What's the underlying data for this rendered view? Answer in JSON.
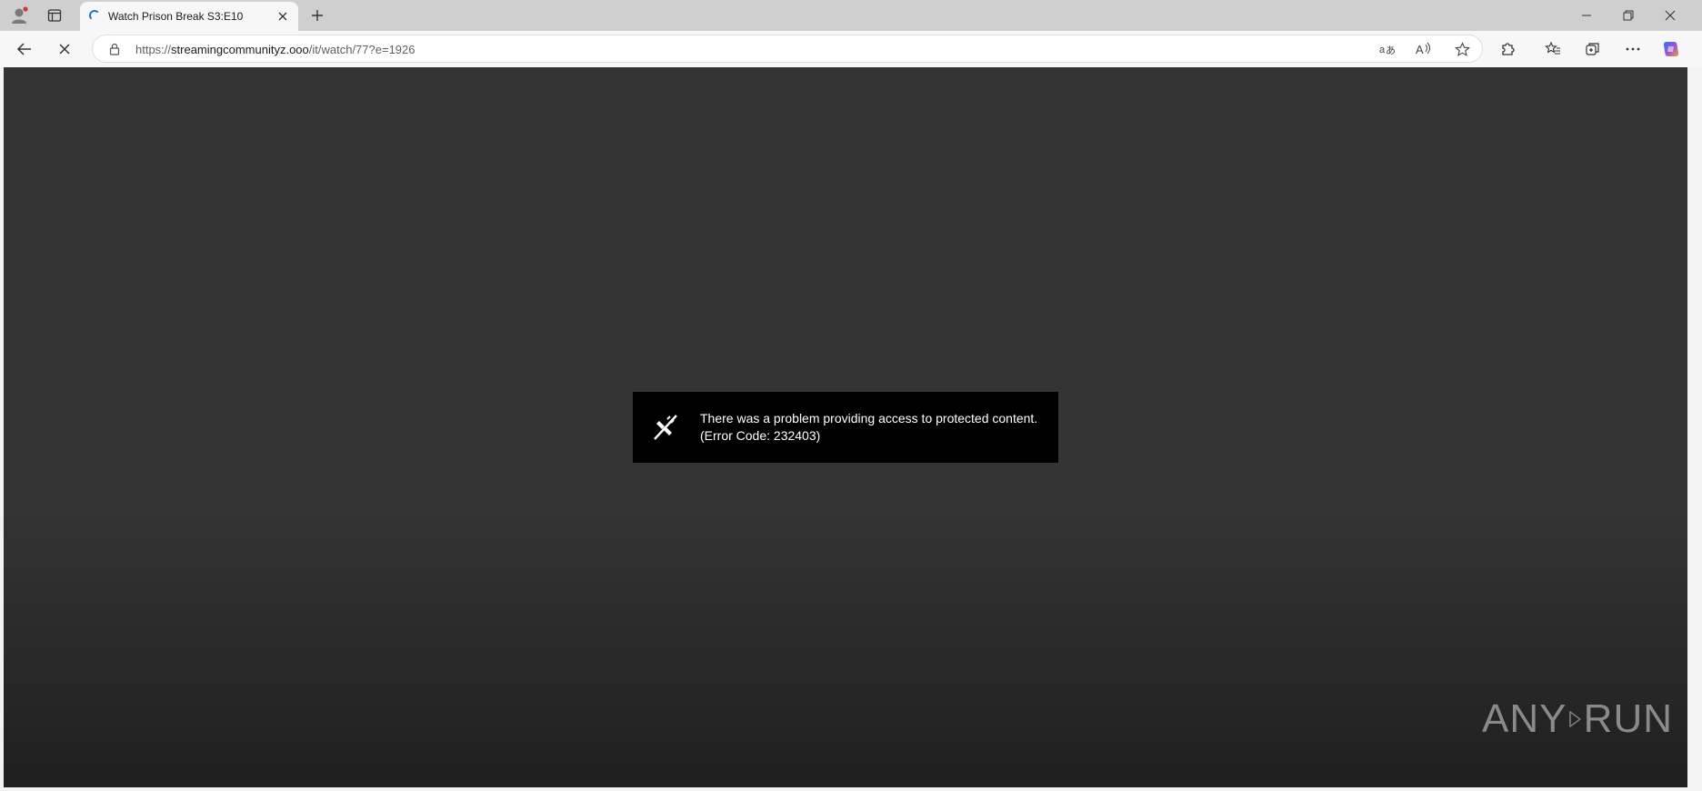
{
  "browser": {
    "tab": {
      "title": "Watch Prison Break S3:E10"
    },
    "address": {
      "scheme": "https://",
      "host": "streamingcommunityz.ooo",
      "path": "/it/watch/77?e=1926"
    }
  },
  "player": {
    "error": {
      "line1": "There was a problem providing access to protected content.",
      "line2": "(Error Code: 232403)"
    }
  },
  "watermark": {
    "left": "ANY",
    "right": "RUN"
  },
  "icons": {
    "profile": "profile-icon",
    "tab_actions": "tab-actions-icon",
    "loading": "loading-spinner-icon",
    "close_tab": "close-icon",
    "new_tab": "plus-icon",
    "minimize": "minimize-icon",
    "restore": "restore-icon",
    "close_window": "close-icon",
    "back": "back-arrow-icon",
    "stop": "stop-icon",
    "lock": "lock-icon",
    "translate": "translate-icon",
    "read_aloud": "read-aloud-icon",
    "favorite": "star-icon",
    "extensions": "puzzle-icon",
    "favorites": "favorites-icon",
    "collections": "collections-icon",
    "more": "more-icon",
    "copilot": "copilot-icon",
    "drm_error": "broken-plug-icon"
  },
  "colors": {
    "content_bg": "#343434",
    "error_bg": "#000000",
    "tab_loading": "#1a73e8"
  }
}
